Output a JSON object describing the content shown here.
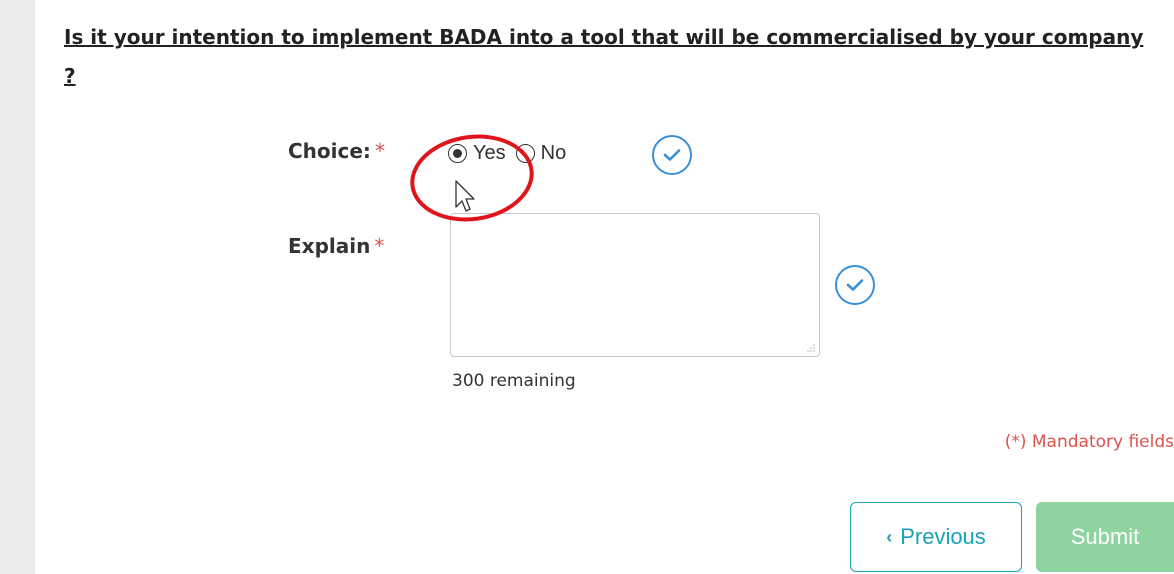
{
  "question": {
    "text": "Is it your intention to implement BADA into a tool that will be commercialised by your company ?"
  },
  "form": {
    "choice": {
      "label": "Choice:",
      "required_mark": "*",
      "options": [
        {
          "label": "Yes",
          "selected": true
        },
        {
          "label": "No",
          "selected": false
        }
      ],
      "validated_icon": "check-circle-icon"
    },
    "explain": {
      "label": "Explain",
      "required_mark": "*",
      "value": "",
      "remaining_text": "300 remaining",
      "validated_icon": "check-circle-icon"
    },
    "mandatory_note": "(*) Mandatory fields"
  },
  "buttons": {
    "previous_icon": "‹",
    "previous_label": "Previous",
    "submit_label": "Submit"
  },
  "colors": {
    "accent": "#17a2b8",
    "check_blue": "#3a8fd8",
    "required_red": "#d9534f",
    "submit_disabled": "#8fd4a0",
    "annotation_red": "#e0151b"
  },
  "annotation": {
    "type": "red-ellipse-highlight",
    "target": "Yes radio option"
  }
}
